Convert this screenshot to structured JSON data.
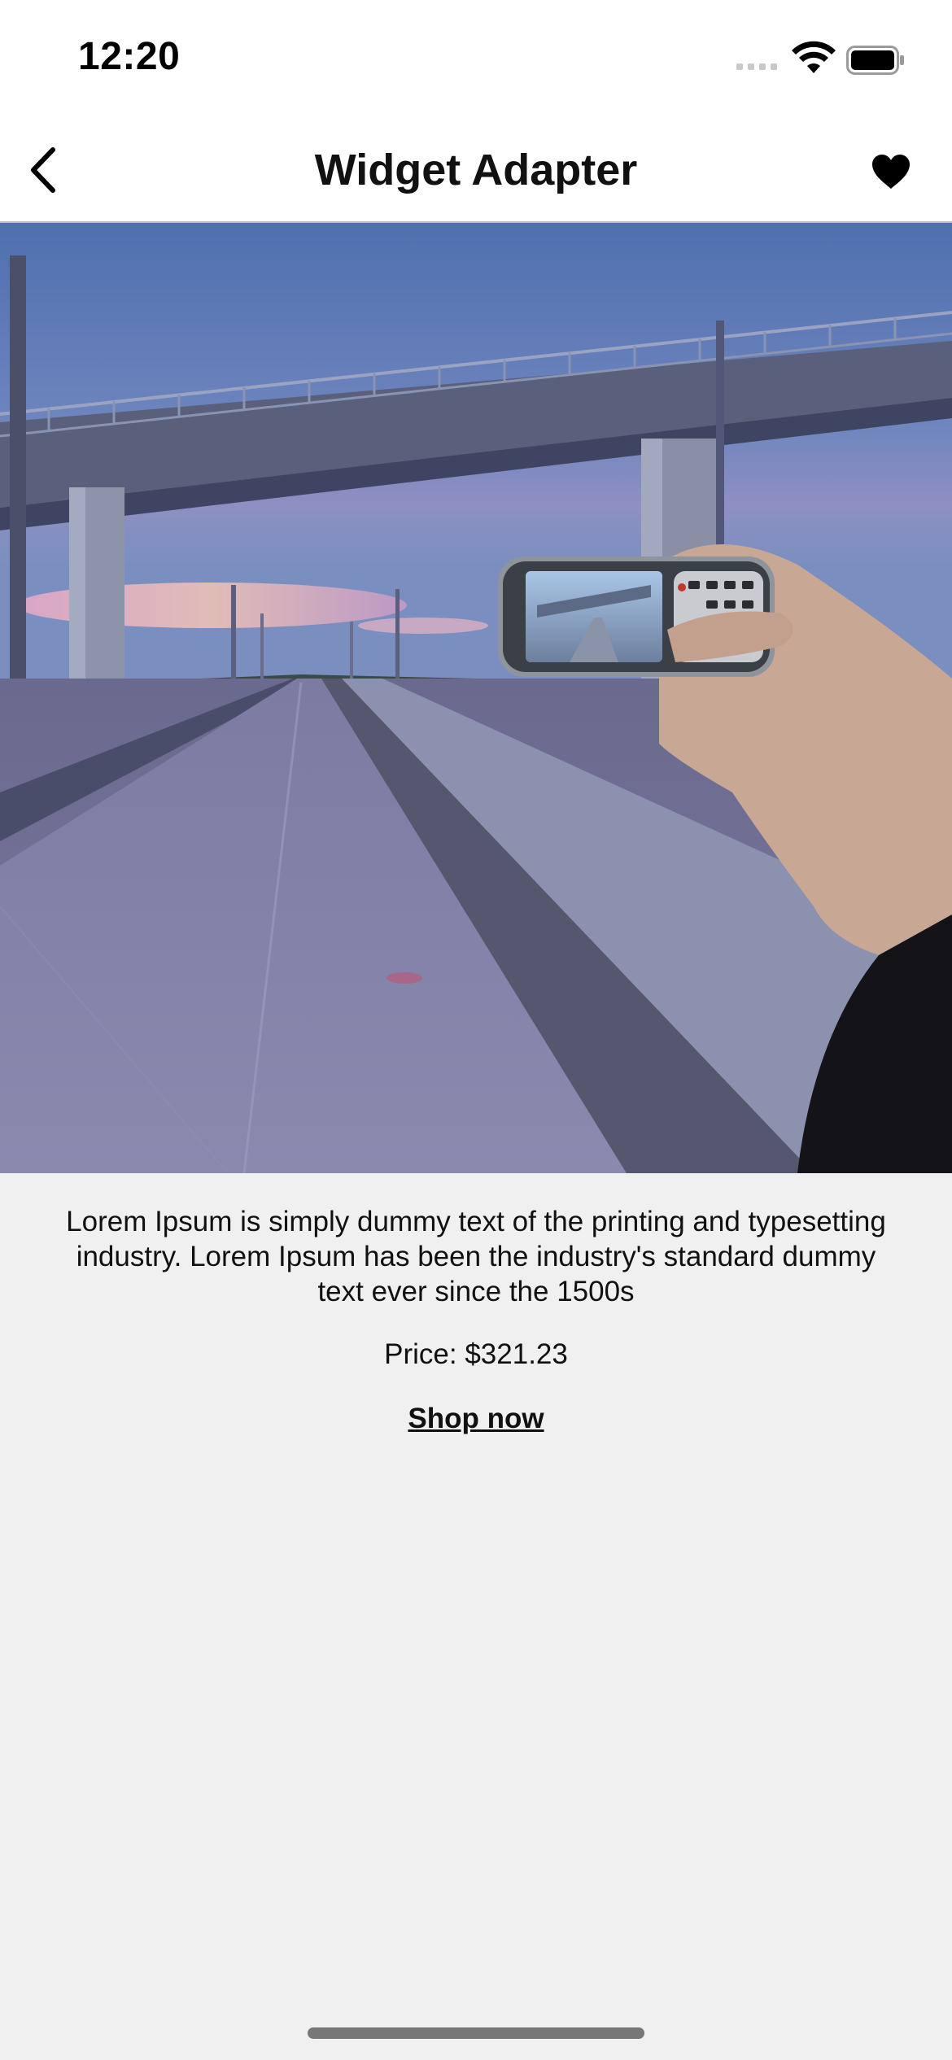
{
  "status_bar": {
    "time": "12:20"
  },
  "nav": {
    "title": "Widget Adapter",
    "back_icon": "chevron-left-icon",
    "favorite_icon": "heart-icon"
  },
  "product": {
    "description": "Lorem Ipsum is simply dummy text of the printing and typesetting industry. Lorem Ipsum has been the industry's standard dummy text ever since the 1500s",
    "price": "Price: $321.23",
    "cta": "Shop now"
  },
  "colors": {
    "background": "#f0f0f0",
    "bar_background": "#ffffff",
    "text": "#111111"
  }
}
